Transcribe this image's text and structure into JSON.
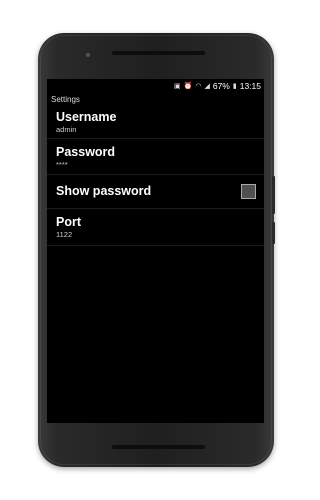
{
  "status_bar": {
    "icons": [
      "nfc-icon",
      "alarm-icon",
      "wifi-icon",
      "signal-icon"
    ],
    "battery": "67%",
    "battery_icon": "battery-icon",
    "time": "13:15"
  },
  "app_bar": {
    "title": "Settings"
  },
  "preferences": [
    {
      "title": "Username",
      "summary": "admin"
    },
    {
      "title": "Password",
      "summary": "****"
    },
    {
      "title": "Show password",
      "checked": false
    },
    {
      "title": "Port",
      "summary": "1122"
    }
  ],
  "colors": {
    "background": "#000000",
    "text": "#ffffff",
    "checkbox_fill": "#505050"
  }
}
